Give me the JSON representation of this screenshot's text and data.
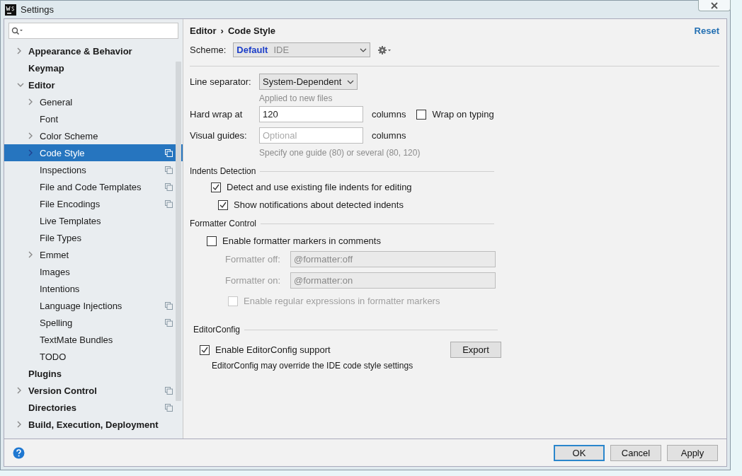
{
  "window": {
    "title": "Settings"
  },
  "sidebar": {
    "items": [
      {
        "label": "Appearance & Behavior",
        "kind": "folder",
        "expanded": false,
        "selected": false,
        "project_icon": false
      },
      {
        "label": "Keymap",
        "kind": "page",
        "selected": false,
        "project_icon": false
      },
      {
        "label": "Editor",
        "kind": "folder",
        "expanded": true,
        "selected": false,
        "project_icon": false,
        "children": [
          {
            "label": "General",
            "kind": "folder",
            "expanded": false,
            "selected": false,
            "project_icon": false
          },
          {
            "label": "Font",
            "kind": "page",
            "selected": false,
            "project_icon": false
          },
          {
            "label": "Color Scheme",
            "kind": "folder",
            "expanded": false,
            "selected": false,
            "project_icon": false
          },
          {
            "label": "Code Style",
            "kind": "folder",
            "expanded": false,
            "selected": true,
            "project_icon": true
          },
          {
            "label": "Inspections",
            "kind": "page",
            "selected": false,
            "project_icon": true
          },
          {
            "label": "File and Code Templates",
            "kind": "page",
            "selected": false,
            "project_icon": true
          },
          {
            "label": "File Encodings",
            "kind": "page",
            "selected": false,
            "project_icon": true
          },
          {
            "label": "Live Templates",
            "kind": "page",
            "selected": false,
            "project_icon": false
          },
          {
            "label": "File Types",
            "kind": "page",
            "selected": false,
            "project_icon": false
          },
          {
            "label": "Emmet",
            "kind": "folder",
            "expanded": false,
            "selected": false,
            "project_icon": false
          },
          {
            "label": "Images",
            "kind": "page",
            "selected": false,
            "project_icon": false
          },
          {
            "label": "Intentions",
            "kind": "page",
            "selected": false,
            "project_icon": false
          },
          {
            "label": "Language Injections",
            "kind": "page",
            "selected": false,
            "project_icon": true
          },
          {
            "label": "Spelling",
            "kind": "page",
            "selected": false,
            "project_icon": true
          },
          {
            "label": "TextMate Bundles",
            "kind": "page",
            "selected": false,
            "project_icon": false
          },
          {
            "label": "TODO",
            "kind": "page",
            "selected": false,
            "project_icon": false
          }
        ]
      },
      {
        "label": "Plugins",
        "kind": "page",
        "selected": false,
        "project_icon": false
      },
      {
        "label": "Version Control",
        "kind": "folder",
        "expanded": false,
        "selected": false,
        "project_icon": true
      },
      {
        "label": "Directories",
        "kind": "page",
        "selected": false,
        "project_icon": true
      },
      {
        "label": "Build, Execution, Deployment",
        "kind": "folder",
        "expanded": false,
        "selected": false,
        "project_icon": false
      }
    ]
  },
  "breadcrumb": [
    "Editor",
    "›",
    "Code Style"
  ],
  "reset_link": "Reset",
  "scheme": {
    "label": "Scheme:",
    "name": "Default",
    "scope": "IDE"
  },
  "line_separator": {
    "label": "Line separator:",
    "value": "System-Dependent",
    "hint": "Applied to new files"
  },
  "hard_wrap": {
    "label": "Hard wrap at",
    "value": "120",
    "unit": "columns",
    "wrap_on_typing": {
      "label": "Wrap on typing",
      "checked": false
    }
  },
  "visual_guides": {
    "label": "Visual guides:",
    "placeholder": "Optional",
    "unit": "columns",
    "hint": "Specify one guide (80) or several (80, 120)"
  },
  "sections": [
    {
      "title": "Indents Detection",
      "items": [
        {
          "kind": "checkbox",
          "label": "Detect and use existing file indents for editing",
          "checked": true,
          "disabled": false,
          "indent": false
        },
        {
          "kind": "checkbox",
          "label": "Show notifications about detected indents",
          "checked": true,
          "disabled": false,
          "indent": true
        }
      ]
    },
    {
      "title": "Formatter Control",
      "items": [
        {
          "kind": "checkbox",
          "label": "Enable formatter markers in comments",
          "checked": false,
          "disabled": false,
          "indent": false
        },
        {
          "kind": "field",
          "label": "Formatter off:",
          "value": "@formatter:off",
          "disabled": true
        },
        {
          "kind": "field",
          "label": "Formatter on:",
          "value": "@formatter:on",
          "disabled": true
        },
        {
          "kind": "checkbox",
          "label": "Enable regular expressions in formatter markers",
          "checked": false,
          "disabled": true,
          "indent": true
        }
      ]
    },
    {
      "title": "EditorConfig",
      "items": [
        {
          "kind": "checkbox_button",
          "label": "Enable EditorConfig support",
          "checked": true,
          "button": "Export"
        },
        {
          "kind": "note",
          "label": "EditorConfig may override the IDE code style settings"
        }
      ]
    }
  ],
  "buttons": [
    {
      "label": "OK",
      "default": true
    },
    {
      "label": "Cancel",
      "default": false
    },
    {
      "label": "Apply",
      "default": false
    }
  ]
}
